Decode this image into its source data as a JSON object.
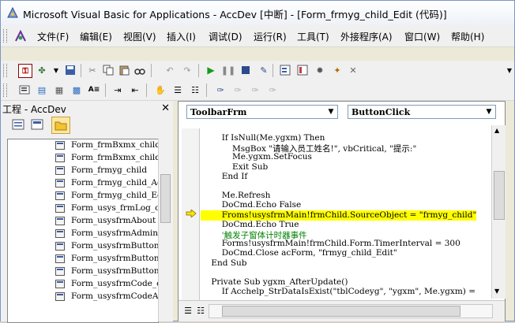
{
  "window": {
    "title": "Microsoft Visual Basic for Applications - AccDev [中断] - [Form_frmyg_child_Edit (代码)]"
  },
  "menu": {
    "items": [
      "文件(F)",
      "编辑(E)",
      "视图(V)",
      "插入(I)",
      "调试(D)",
      "运行(R)",
      "工具(T)",
      "外接程序(A)",
      "窗口(W)",
      "帮助(H)"
    ]
  },
  "project": {
    "title": "工程 - AccDev",
    "items": [
      "Form_frmBxmx_child",
      "Form_frmBxmx_child",
      "Form_frmyg_child",
      "Form_frmyg_child_Ac",
      "Form_frmyg_child_Ed",
      "Form_usys_frmLog_cl",
      "Form_usysfrmAbout",
      "Form_usysfrmAdmin",
      "Form_usysfrmButton",
      "Form_usysfrmButton",
      "Form_usysfrmButton",
      "Form_usysfrmCode_cl",
      "Form_usysfrmCodeAdd"
    ]
  },
  "editor": {
    "object_combo": "ToolbarFrm",
    "proc_combo": "ButtonClick",
    "lines": [
      {
        "text": "        If IsNull(Me.ygxm) Then",
        "style": "code"
      },
      {
        "text": "            MsgBox \"请输入员工姓名!\", vbCritical, \"提示:\"",
        "style": "code"
      },
      {
        "text": "            Me.ygxm.SetFocus",
        "style": "code"
      },
      {
        "text": "            Exit Sub",
        "style": "code"
      },
      {
        "text": "        End If",
        "style": "code"
      },
      {
        "text": "",
        "style": "code"
      },
      {
        "text": "        Me.Refresh",
        "style": "code"
      },
      {
        "text": "        DoCmd.Echo False",
        "style": "code"
      },
      {
        "text": "        Froms!usysfrmMain!frmChild.SourceObject = \"frmyg_child\"",
        "style": "highlight"
      },
      {
        "text": "        DoCmd.Echo True",
        "style": "code"
      },
      {
        "text": "        '触发子窗体计时器事件",
        "style": "comment"
      },
      {
        "text": "        Forms!usysfrmMain!frmChild.Form.TimerInterval = 300",
        "style": "code"
      },
      {
        "text": "        DoCmd.Close acForm, \"frmyg_child_Edit\"",
        "style": "code"
      },
      {
        "text": "    End Sub",
        "style": "code"
      },
      {
        "text": "",
        "style": "code"
      },
      {
        "text": "    Private Sub ygxm_AfterUpdate()",
        "style": "code"
      },
      {
        "text": "        If Acchelp_StrDataIsExist(\"tblCodeyg\", \"ygxm\", Me.ygxm) =",
        "style": "code"
      }
    ]
  },
  "colors": {
    "highlight": "#ffff00",
    "keyword": "#00007f",
    "comment": "#008000",
    "arrow": "#e8c800"
  }
}
